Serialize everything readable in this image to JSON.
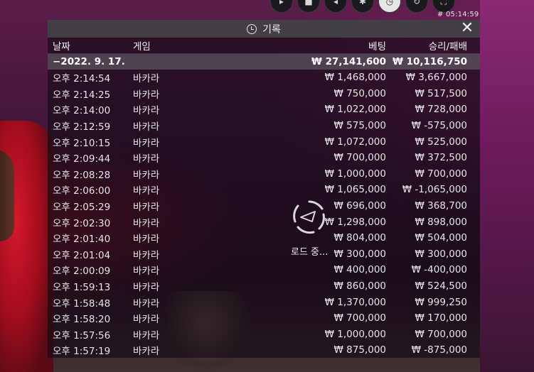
{
  "overlay": {
    "time": "# 05:14:59",
    "controls": [
      "chat-icon",
      "camera-icon",
      "sound-icon",
      "settings-icon",
      "history-icon",
      "refresh-icon",
      "fullscreen-icon"
    ]
  },
  "panel": {
    "title": "기록",
    "columns": {
      "date": "날짜",
      "game": "게임",
      "bet": "베팅",
      "win": "승리/패배"
    },
    "summary": {
      "date": "−2022. 9. 17.",
      "bet": "₩ 27,141,600",
      "win": "₩ 10,116,750"
    },
    "rows": [
      {
        "time": "오후 2:14:54",
        "game": "바카라",
        "bet": "₩ 1,468,000",
        "win": "₩ 3,667,000"
      },
      {
        "time": "오후 2:14:25",
        "game": "바카라",
        "bet": "₩ 750,000",
        "win": "₩ 517,500"
      },
      {
        "time": "오후 2:14:00",
        "game": "바카라",
        "bet": "₩ 1,022,000",
        "win": "₩ 728,000"
      },
      {
        "time": "오후 2:12:59",
        "game": "바카라",
        "bet": "₩ 575,000",
        "win": "₩ -575,000"
      },
      {
        "time": "오후 2:10:15",
        "game": "바카라",
        "bet": "₩ 1,072,000",
        "win": "₩ 525,000"
      },
      {
        "time": "오후 2:09:44",
        "game": "바카라",
        "bet": "₩ 700,000",
        "win": "₩ 372,500"
      },
      {
        "time": "오후 2:08:28",
        "game": "바카라",
        "bet": "₩ 1,000,000",
        "win": "₩ 700,000"
      },
      {
        "time": "오후 2:06:00",
        "game": "바카라",
        "bet": "₩ 1,065,000",
        "win": "₩ -1,065,000"
      },
      {
        "time": "오후 2:05:29",
        "game": "바카라",
        "bet": "₩ 696,000",
        "win": "₩ 368,700"
      },
      {
        "time": "오후 2:02:30",
        "game": "바카라",
        "bet": "₩ 1,298,000",
        "win": "₩ 898,000"
      },
      {
        "time": "오후 2:01:40",
        "game": "바카라",
        "bet": "₩ 804,000",
        "win": "₩ 504,000"
      },
      {
        "time": "오후 2:01:04",
        "game": "바카라",
        "bet": "₩ 300,000",
        "win": "₩ 300,000"
      },
      {
        "time": "오후 2:00:09",
        "game": "바카라",
        "bet": "₩ 400,000",
        "win": "₩ -400,000"
      },
      {
        "time": "오후 1:59:13",
        "game": "바카라",
        "bet": "₩ 860,000",
        "win": "₩ 524,500"
      },
      {
        "time": "오후 1:58:48",
        "game": "바카라",
        "bet": "₩ 1,370,000",
        "win": "₩ 999,250"
      },
      {
        "time": "오후 1:58:20",
        "game": "바카라",
        "bet": "₩ 700,000",
        "win": "₩ 170,000"
      },
      {
        "time": "오후 1:57:56",
        "game": "바카라",
        "bet": "₩ 1,000,000",
        "win": "₩ 700,000"
      },
      {
        "time": "오후 1:57:19",
        "game": "바카라",
        "bet": "₩ 875,000",
        "win": "₩ -875,000"
      }
    ],
    "loading_text": "로드 중..."
  }
}
